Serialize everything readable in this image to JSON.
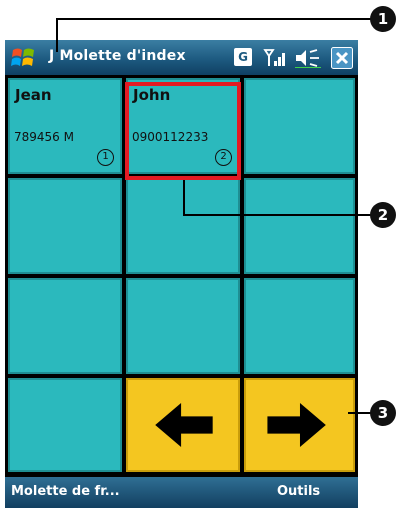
{
  "window": {
    "title": "J Molette d'index",
    "status_icons": [
      "start-logo",
      "g-icon",
      "signal-icon",
      "speaker-icon",
      "close-icon"
    ],
    "g_label": "G"
  },
  "contacts": [
    {
      "name": "Jean",
      "number": "789456 M",
      "index": "1"
    },
    {
      "name": "John",
      "number": "0900112233",
      "index": "2"
    }
  ],
  "menubar": {
    "left_label": "Molette de fr...",
    "right_label": "Outils"
  },
  "callouts": [
    {
      "label": "1"
    },
    {
      "label": "2"
    },
    {
      "label": "3"
    }
  ],
  "colors": {
    "cell": "#2bb9bd",
    "nav_button": "#f4c620",
    "highlight": "#e41b23",
    "titlebar": "#1d5a80"
  }
}
